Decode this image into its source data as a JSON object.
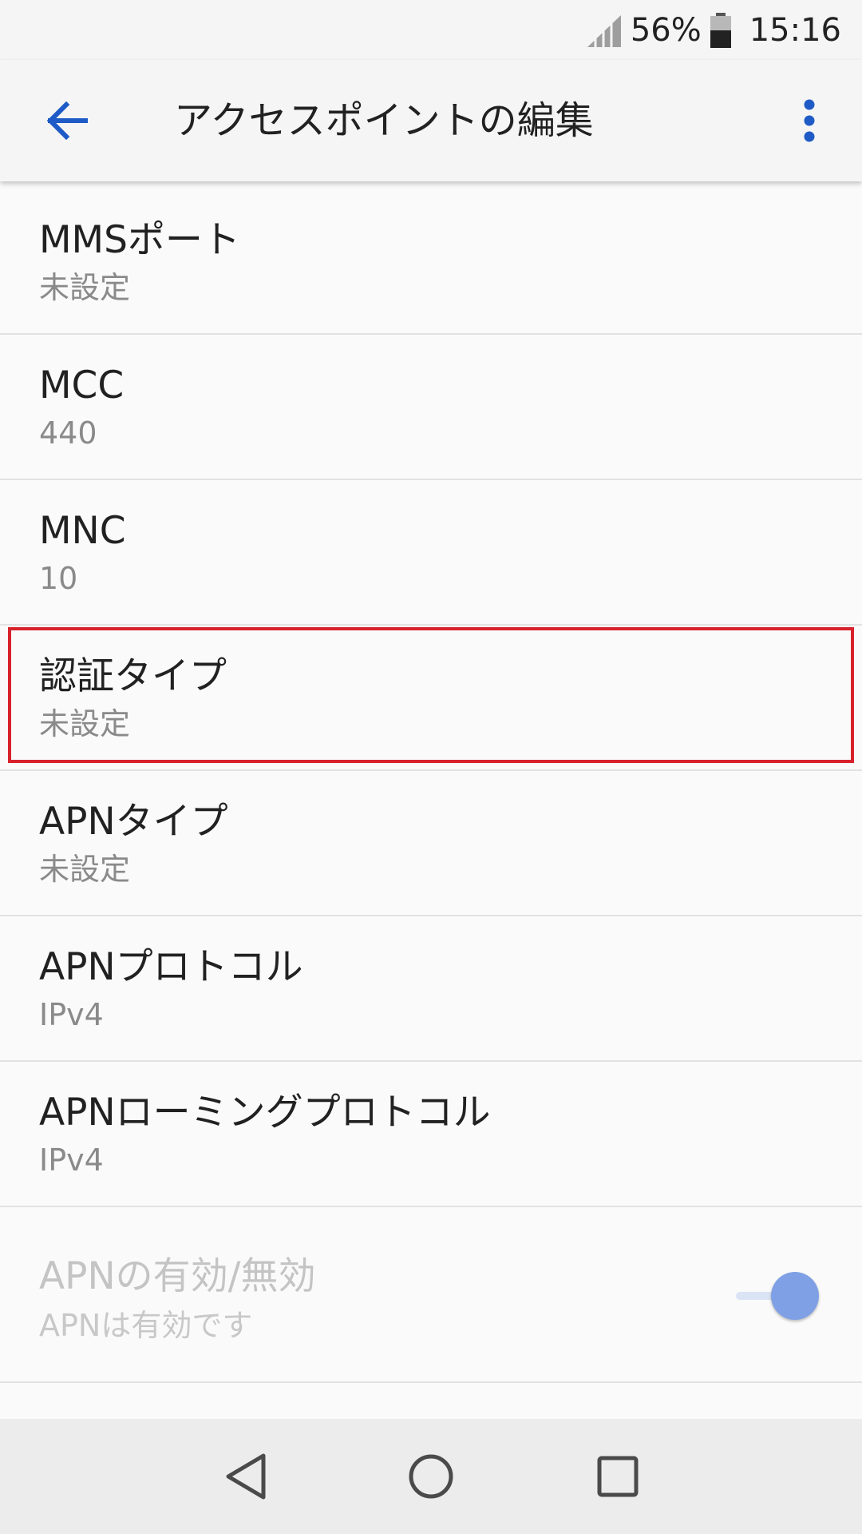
{
  "status_bar": {
    "battery_percent": "56%",
    "time": "15:16",
    "icons": [
      "signal-icon",
      "battery-icon"
    ]
  },
  "app_bar": {
    "title": "アクセスポイントの編集",
    "back_icon": "arrow-left-icon",
    "menu_icon": "more-vertical-icon",
    "accent_color": "#1e5bc6"
  },
  "settings": {
    "items": [
      {
        "title": "MMSポート",
        "summary": "未設定"
      },
      {
        "title": "MCC",
        "summary": "440"
      },
      {
        "title": "MNC",
        "summary": "10"
      },
      {
        "title": "認証タイプ",
        "summary": "未設定"
      },
      {
        "title": "APNタイプ",
        "summary": "未設定"
      },
      {
        "title": "APNプロトコル",
        "summary": "IPv4"
      },
      {
        "title": "APNローミングプロトコル",
        "summary": "IPv4"
      }
    ],
    "toggle": {
      "title": "APNの有効/無効",
      "summary": "APNは有効です",
      "state": "on",
      "enabled": false
    },
    "highlight_color": "#d8222b"
  },
  "nav_bar": {
    "icons": [
      "back-triangle-icon",
      "home-circle-icon",
      "recents-square-icon"
    ]
  }
}
